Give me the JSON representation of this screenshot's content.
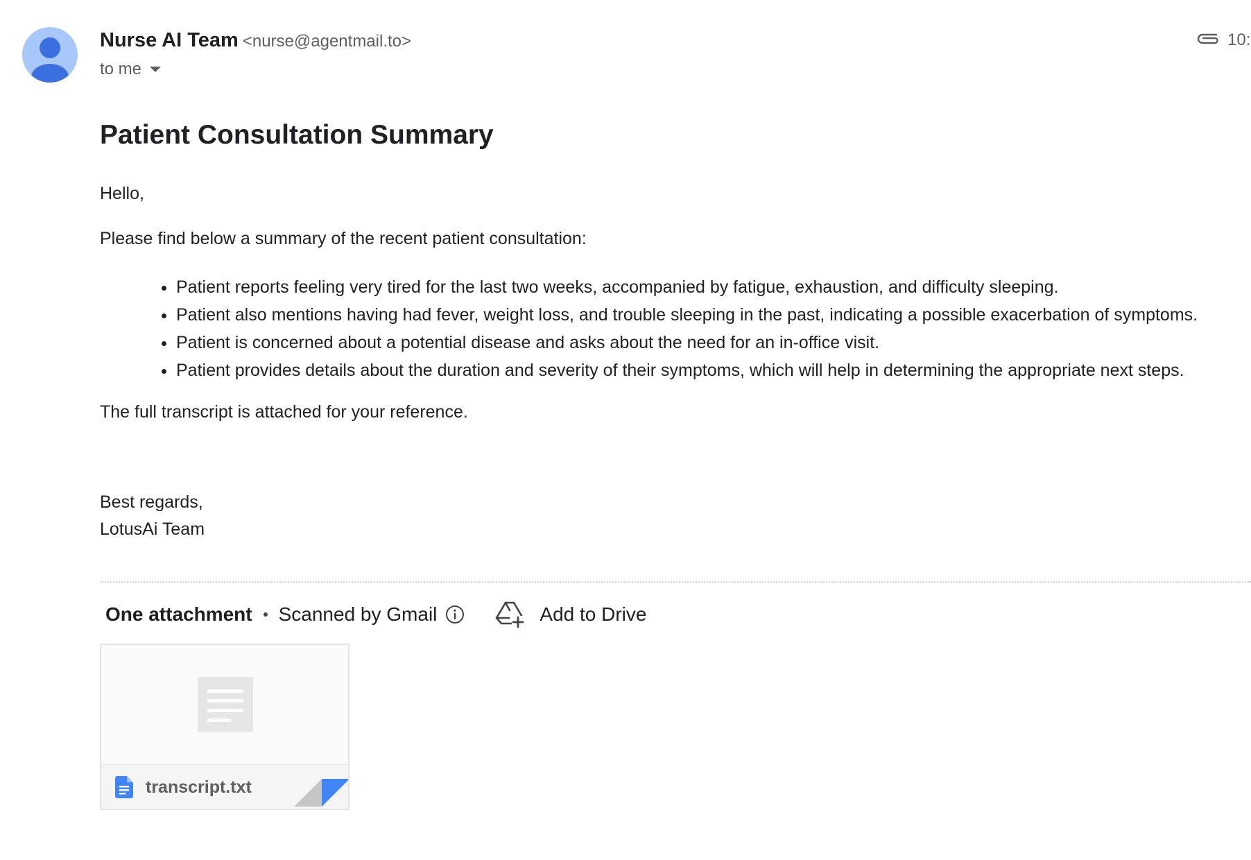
{
  "header": {
    "sender_name": "Nurse AI Team",
    "sender_email": "<nurse@agentmail.to>",
    "recipient": "to me",
    "time_partial": "10:"
  },
  "email": {
    "subject": "Patient Consultation Summary",
    "greeting": "Hello,",
    "intro": "Please find below a summary of the recent patient consultation:",
    "bullets": [
      "Patient reports feeling very tired for the last two weeks, accompanied by fatigue, exhaustion, and difficulty sleeping.",
      "Patient also mentions having had fever, weight loss, and trouble sleeping in the past, indicating a possible exacerbation of symptoms.",
      "Patient is concerned about a potential disease and asks about the need for an in-office visit.",
      "Patient provides details about the duration and severity of their symptoms, which will help in determining the appropriate next steps."
    ],
    "closing_note": "The full transcript is attached for your reference.",
    "signoff": "Best regards,",
    "signature": "LotusAi Team"
  },
  "attachments": {
    "count_label": "One attachment",
    "scanned_label": "Scanned by Gmail",
    "add_to_drive_label": "Add to Drive",
    "files": [
      {
        "name": "transcript.txt",
        "icon": "doc-file-icon"
      }
    ]
  },
  "colors": {
    "avatar_bg": "#a8c7fa",
    "avatar_fg": "#3b6fe0",
    "file_icon": "#4285f4",
    "text_primary": "#202124",
    "text_secondary": "#5e5e5e"
  }
}
